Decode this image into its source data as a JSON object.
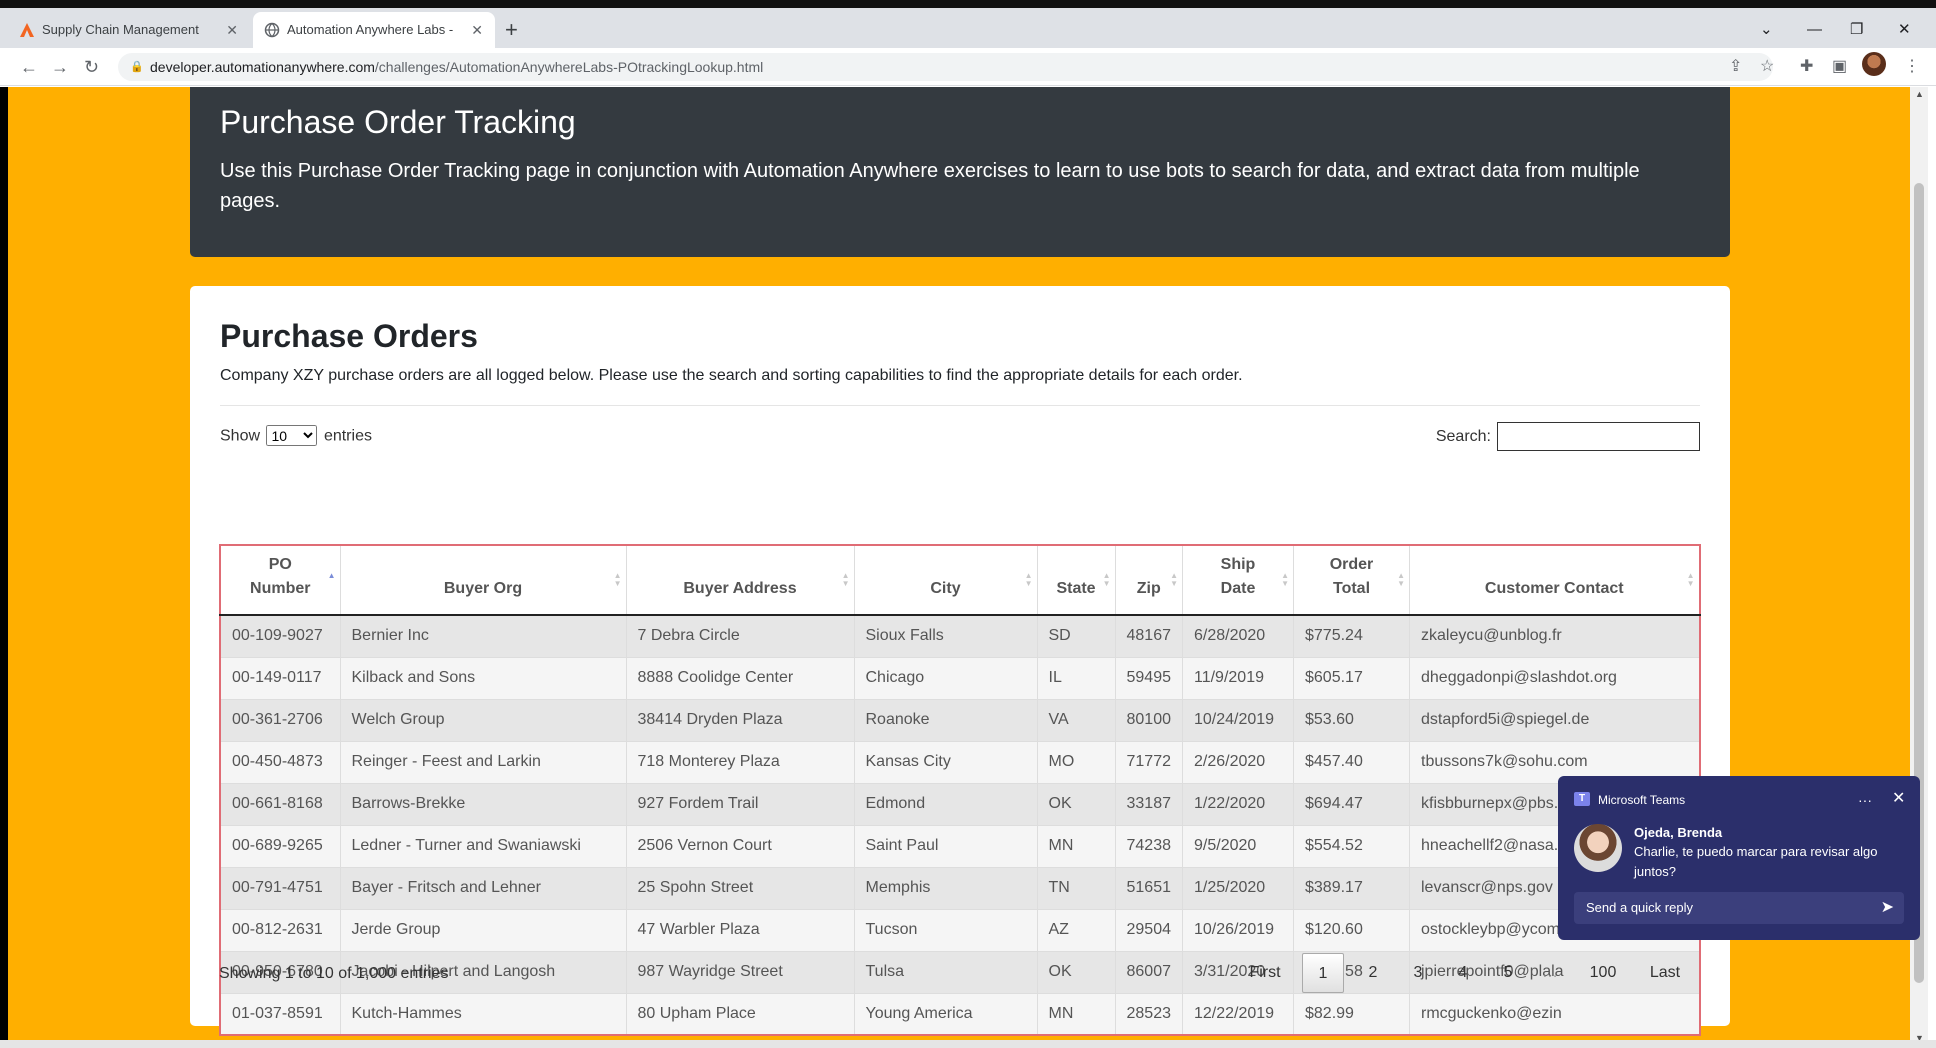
{
  "browser": {
    "tabs": [
      {
        "title": "Supply Chain Management"
      },
      {
        "title": "Automation Anywhere Labs - PO"
      }
    ],
    "url_domain": "developer.automationanywhere.com",
    "url_path": "/challenges/AutomationAnywhereLabs-POtrackingLookup.html"
  },
  "hero": {
    "title": "Purchase Order Tracking",
    "description": "Use this Purchase Order Tracking page in conjunction with Automation Anywhere exercises to learn to use bots to search for data, and extract data from multiple pages."
  },
  "card": {
    "title": "Purchase Orders",
    "description": "Company XZY purchase orders are all logged below. Please use the search and sorting capabilities to find the appropriate details for each order."
  },
  "controls": {
    "show_label": "Show",
    "entries_label": "entries",
    "page_length": "10",
    "search_label": "Search:",
    "search_value": ""
  },
  "table": {
    "columns": [
      {
        "line1": "PO",
        "line2": "Number"
      },
      {
        "line1": "",
        "line2": "Buyer Org"
      },
      {
        "line1": "",
        "line2": "Buyer Address"
      },
      {
        "line1": "",
        "line2": "City"
      },
      {
        "line1": "",
        "line2": "State"
      },
      {
        "line1": "",
        "line2": "Zip"
      },
      {
        "line1": "Ship",
        "line2": "Date"
      },
      {
        "line1": "Order",
        "line2": "Total"
      },
      {
        "line1": "",
        "line2": "Customer Contact"
      }
    ],
    "rows": [
      [
        "00-109-9027",
        "Bernier Inc",
        "7 Debra Circle",
        "Sioux Falls",
        "SD",
        "48167",
        "6/28/2020",
        "$775.24",
        "zkaleycu@unblog.fr"
      ],
      [
        "00-149-0117",
        "Kilback and Sons",
        "8888 Coolidge Center",
        "Chicago",
        "IL",
        "59495",
        "11/9/2019",
        "$605.17",
        "dheggadonpi@slashdot.org"
      ],
      [
        "00-361-2706",
        "Welch Group",
        "38414 Dryden Plaza",
        "Roanoke",
        "VA",
        "80100",
        "10/24/2019",
        "$53.60",
        "dstapford5i@spiegel.de"
      ],
      [
        "00-450-4873",
        "Reinger - Feest and Larkin",
        "718 Monterey Plaza",
        "Kansas City",
        "MO",
        "71772",
        "2/26/2020",
        "$457.40",
        "tbussons7k@sohu.com"
      ],
      [
        "00-661-8168",
        "Barrows-Brekke",
        "927 Fordem Trail",
        "Edmond",
        "OK",
        "33187",
        "1/22/2020",
        "$694.47",
        "kfisbburnepx@pbs.org"
      ],
      [
        "00-689-9265",
        "Ledner - Turner and Swaniawski",
        "2506 Vernon Court",
        "Saint Paul",
        "MN",
        "74238",
        "9/5/2020",
        "$554.52",
        "hneachellf2@nasa.gov"
      ],
      [
        "00-791-4751",
        "Bayer - Fritsch and Lehner",
        "25 Spohn Street",
        "Memphis",
        "TN",
        "51651",
        "1/25/2020",
        "$389.17",
        "levanscr@nps.gov"
      ],
      [
        "00-812-2631",
        "Jerde Group",
        "47 Warbler Plaza",
        "Tucson",
        "AZ",
        "29504",
        "10/26/2019",
        "$120.60",
        "ostockleybp@ycom"
      ],
      [
        "00-950-6780",
        "Jacobi - Hilpert and Langosh",
        "987 Wayridge Street",
        "Tulsa",
        "OK",
        "86007",
        "3/31/2020",
        "$868.58",
        "jpierrepointf0@plala"
      ],
      [
        "01-037-8591",
        "Kutch-Hammes",
        "80 Upham Place",
        "Young America",
        "MN",
        "28523",
        "12/22/2019",
        "$82.99",
        "rmcguckenko@ezin"
      ]
    ]
  },
  "footer": {
    "info": "Showing 1 to 10 of 1,000 entries",
    "pages": [
      "First",
      "1",
      "2",
      "3",
      "4",
      "5",
      "…",
      "100",
      "Last"
    ]
  },
  "toast": {
    "app_name": "Microsoft Teams",
    "more": "···",
    "sender": "Ojeda, Brenda",
    "message": "Charlie, te puedo marcar para revisar algo juntos?",
    "reply_placeholder": "Send a quick reply"
  },
  "colors": {
    "page_background": "#ffaf00",
    "hero_background": "#343a40",
    "table_border": "#e06c75",
    "toast_background": "#2b2f6b"
  }
}
